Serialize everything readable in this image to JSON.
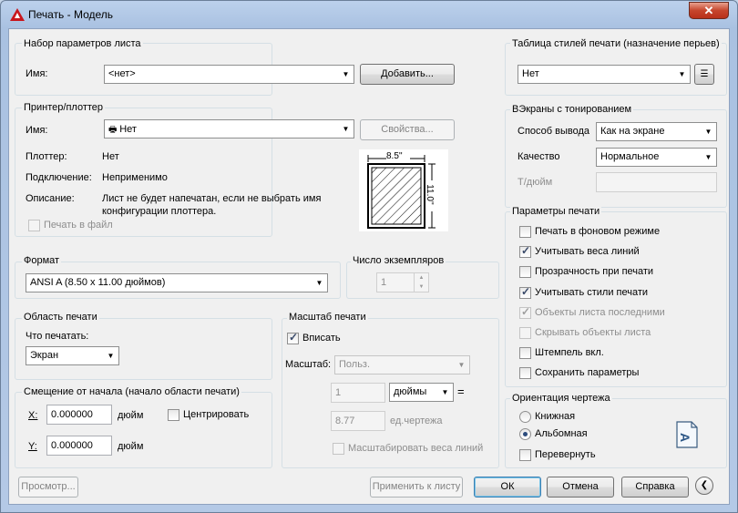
{
  "window": {
    "title": "Печать - Модель",
    "close_glyph": "✕"
  },
  "page_setup": {
    "group_title": "Набор параметров листа",
    "name_label": "Имя:",
    "name_value": "<нет>",
    "add_button": "Добавить..."
  },
  "printer": {
    "group_title": "Принтер/плоттер",
    "name_label": "Имя:",
    "name_value": "Нет",
    "properties_button": "Свойства...",
    "plotter_label": "Плоттер:",
    "plotter_value": "Нет",
    "connection_label": "Подключение:",
    "connection_value": "Неприменимо",
    "description_label": "Описание:",
    "description_line1": "Лист не будет напечатан, если не выбрать имя",
    "description_line2": "конфигурации плоттера.",
    "print_to_file": "Печать в файл",
    "preview_width": "8.5''",
    "preview_height": "11.0''"
  },
  "paper_size": {
    "group_title": "Формат",
    "value": "ANSI A (8.50 x 11.00 дюймов)"
  },
  "copies": {
    "group_title": "Число экземпляров",
    "value": "1"
  },
  "plot_area": {
    "group_title": "Область печати",
    "what_label": "Что печатать:",
    "what_value": "Экран"
  },
  "offset": {
    "group_title": "Смещение от начала (начало области печати)",
    "x_label": "X:",
    "x_value": "0.000000",
    "x_unit": "дюйм",
    "y_label": "Y:",
    "y_value": "0.000000",
    "y_unit": "дюйм",
    "center_label": "Центрировать"
  },
  "scale": {
    "group_title": "Масштаб печати",
    "fit_label": "Вписать",
    "scale_label": "Масштаб:",
    "scale_value": "Польз.",
    "value1": "1",
    "unit_value": "дюймы",
    "equals": "=",
    "value2": "8.77",
    "drawing_units": "ед.чертежа",
    "scale_lineweights": "Масштабировать веса линий"
  },
  "style_table": {
    "group_title": "Таблица стилей печати (назначение перьев)",
    "value": "Нет"
  },
  "shaded": {
    "group_title": "ВЭкраны с тонированием",
    "output_label": "Способ вывода",
    "output_value": "Как на экране",
    "quality_label": "Качество",
    "quality_value": "Нормальное",
    "dpi_label": "Т/дюйм",
    "dpi_value": ""
  },
  "options": {
    "group_title": "Параметры печати",
    "items": [
      {
        "label": "Печать в фоновом режиме",
        "checked": false,
        "enabled": true
      },
      {
        "label": "Учитывать веса линий",
        "checked": true,
        "enabled": true
      },
      {
        "label": "Прозрачность при печати",
        "checked": false,
        "enabled": true
      },
      {
        "label": "Учитывать стили печати",
        "checked": true,
        "enabled": true
      },
      {
        "label": "Объекты листа последними",
        "checked": true,
        "enabled": false
      },
      {
        "label": "Скрывать объекты листа",
        "checked": false,
        "enabled": false
      },
      {
        "label": "Штемпель вкл.",
        "checked": false,
        "enabled": true
      },
      {
        "label": "Сохранить параметры",
        "checked": false,
        "enabled": true
      }
    ]
  },
  "orientation": {
    "group_title": "Ориентация чертежа",
    "portrait": "Книжная",
    "landscape": "Альбомная",
    "upside_down": "Перевернуть",
    "icon_letter": "A"
  },
  "footer": {
    "preview": "Просмотр...",
    "apply": "Применить к листу",
    "ok": "ОК",
    "cancel": "Отмена",
    "help": "Справка",
    "collapse_glyph": "❮"
  }
}
